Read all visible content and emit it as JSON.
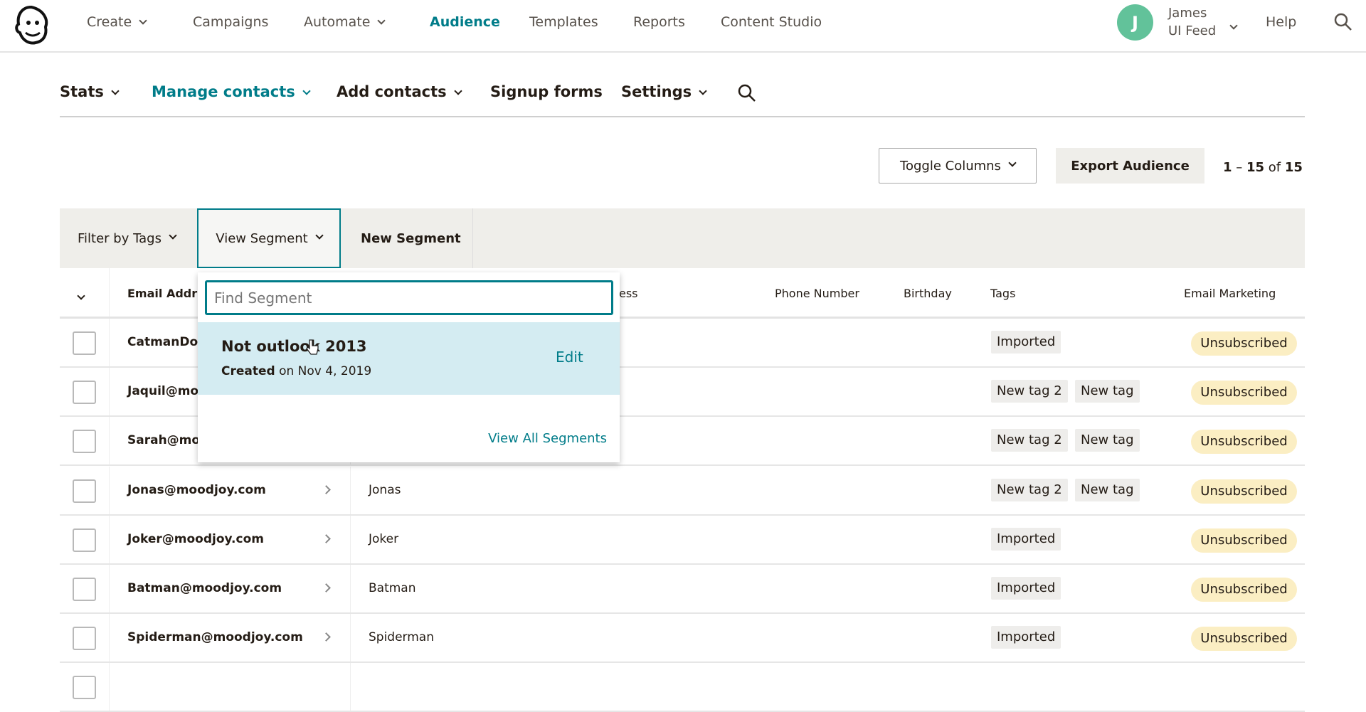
{
  "topnav": {
    "items": [
      {
        "label": "Create",
        "chevron": true
      },
      {
        "label": "Campaigns"
      },
      {
        "label": "Automate",
        "chevron": true
      },
      {
        "label": "Audience",
        "active": true
      },
      {
        "label": "Templates"
      },
      {
        "label": "Reports"
      },
      {
        "label": "Content Studio"
      }
    ],
    "avatar_initial": "J",
    "user_name": "James",
    "user_org": "UI Feed",
    "help": "Help",
    "icons": {
      "logo": "mailchimp-freddie-logo",
      "search": "search-icon"
    }
  },
  "subnav": {
    "items": [
      {
        "label": "Stats"
      },
      {
        "label": "Manage contacts",
        "active": true
      },
      {
        "label": "Add contacts"
      },
      {
        "label": "Signup forms",
        "nochev": true
      },
      {
        "label": "Settings"
      }
    ]
  },
  "toolbar": {
    "toggle_columns": "Toggle Columns",
    "export": "Export Audience",
    "pagination": {
      "start": "1",
      "end": "15",
      "sep": " – ",
      "of": " of ",
      "total": "15"
    }
  },
  "filterbar": {
    "filter_tags": "Filter by Tags",
    "view_segment": "View Segment",
    "new_segment": "New Segment"
  },
  "table": {
    "headers": {
      "email": "Email Addr",
      "address": "ess",
      "phone": "Phone Number",
      "birthday": "Birthday",
      "tags": "Tags",
      "marketing": "Email Marketing"
    },
    "rows": [
      {
        "email": "CatmanDor",
        "first": "",
        "tags": [
          "Imported"
        ],
        "status": "Unsubscribed"
      },
      {
        "email": "Jaquil@mo",
        "first": "",
        "tags": [
          "New tag 2",
          "New tag"
        ],
        "status": "Unsubscribed"
      },
      {
        "email": "Sarah@mo",
        "first": "",
        "tags": [
          "New tag 2",
          "New tag"
        ],
        "status": "Unsubscribed"
      },
      {
        "email": "Jonas@moodjoy.com",
        "first": "Jonas",
        "tags": [
          "New tag 2",
          "New tag"
        ],
        "status": "Unsubscribed"
      },
      {
        "email": "Joker@moodjoy.com",
        "first": "Joker",
        "tags": [
          "Imported"
        ],
        "status": "Unsubscribed"
      },
      {
        "email": "Batman@moodjoy.com",
        "first": "Batman",
        "tags": [
          "Imported"
        ],
        "status": "Unsubscribed"
      },
      {
        "email": "Spiderman@moodjoy.com",
        "first": "Spiderman",
        "tags": [
          "Imported"
        ],
        "status": "Unsubscribed"
      }
    ]
  },
  "segment_dropdown": {
    "search_placeholder": "Find Segment",
    "segments": [
      {
        "name": "Not outlook 2013",
        "created_label": "Created",
        "created_date": " on Nov 4, 2019",
        "edit": "Edit"
      }
    ],
    "view_all": "View All Segments"
  },
  "colors": {
    "accent": "#007c89",
    "avatar": "#62c29a",
    "unsubscribed": "#fbeec3",
    "highlight": "#d4ecf2"
  }
}
